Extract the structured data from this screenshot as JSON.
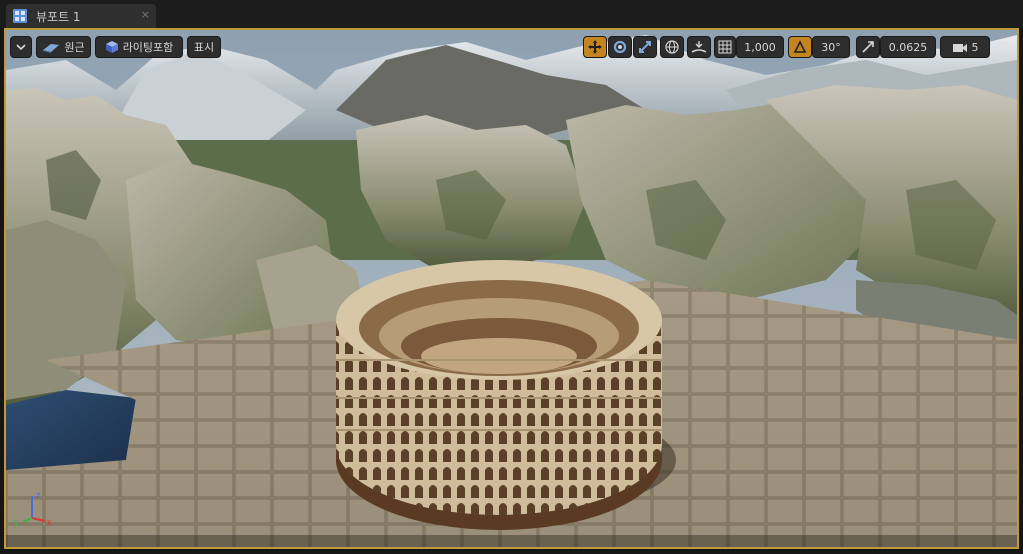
{
  "tab": {
    "title": "뷰포트 1",
    "close": "×"
  },
  "toolbar": {
    "menu_icon": "dropdown-arrow-icon",
    "perspective": "원근",
    "lighting": "라이팅포함",
    "show": "표시",
    "transform_modes": [
      "translate-icon",
      "rotate-icon",
      "scale-icon"
    ],
    "active_transform": "translate",
    "grid_snap": "1,000",
    "rotation_snap": "30°",
    "scale_snap": "0.0625",
    "camera_speed": "5"
  },
  "axis": {
    "x": "x",
    "y": "y",
    "z": "z"
  },
  "colors": {
    "border": "#c09a3a",
    "active": "#c48420",
    "x_axis": "#d43a3a",
    "y_axis": "#3ab54a",
    "z_axis": "#4a6ae0"
  }
}
